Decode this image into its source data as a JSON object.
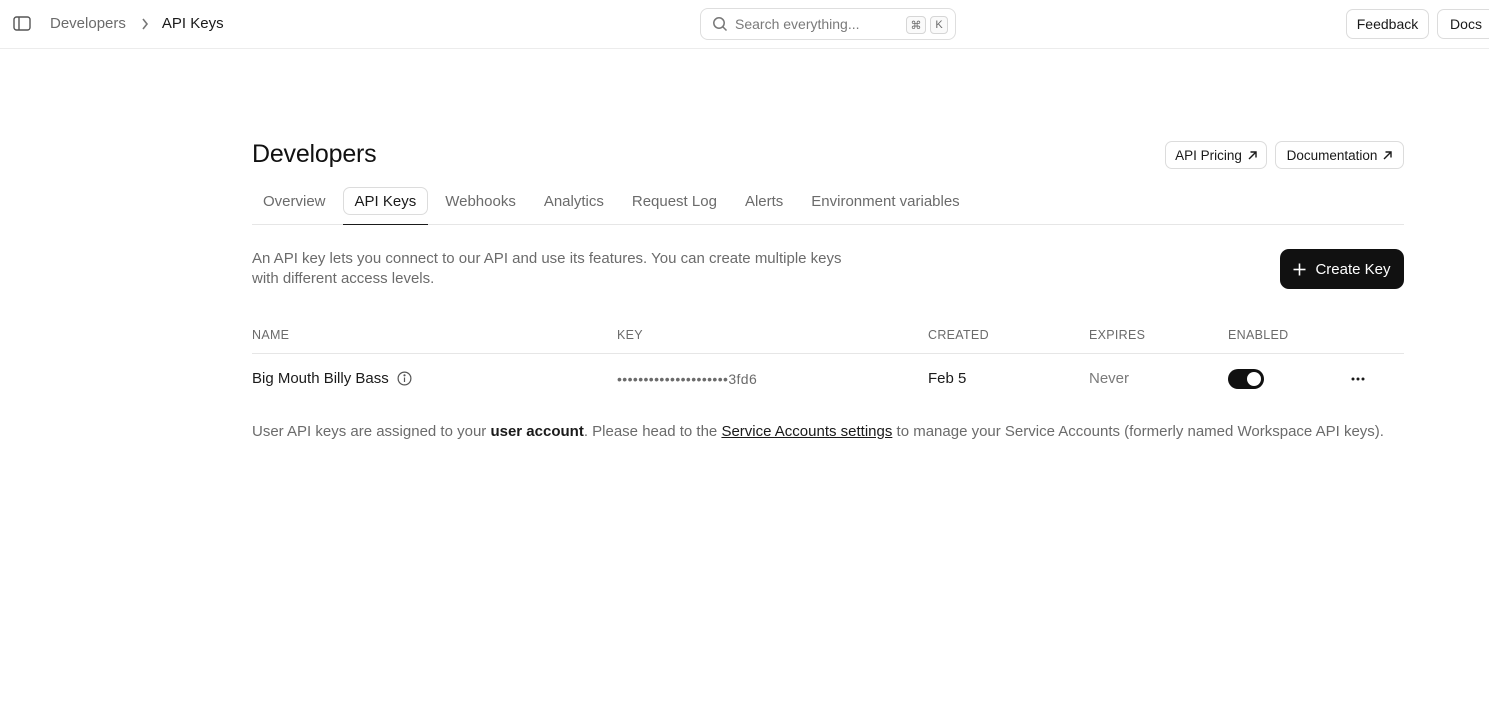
{
  "topbar": {
    "breadcrumb": {
      "parent": "Developers",
      "current": "API Keys"
    },
    "search": {
      "placeholder": "Search everything...",
      "shortcut_mod": "⌘",
      "shortcut_key": "K"
    },
    "feedback_label": "Feedback",
    "docs_label": "Docs"
  },
  "header": {
    "title": "Developers",
    "pricing_label": "API Pricing",
    "documentation_label": "Documentation"
  },
  "tabs": [
    {
      "label": "Overview",
      "active": false
    },
    {
      "label": "API Keys",
      "active": true
    },
    {
      "label": "Webhooks",
      "active": false
    },
    {
      "label": "Analytics",
      "active": false
    },
    {
      "label": "Request Log",
      "active": false
    },
    {
      "label": "Alerts",
      "active": false
    },
    {
      "label": "Environment variables",
      "active": false
    }
  ],
  "description": "An API key lets you connect to our API and use its features. You can create multiple keys with different access levels.",
  "create_label": "Create Key",
  "table": {
    "columns": {
      "name": "NAME",
      "key": "KEY",
      "created": "CREATED",
      "expires": "EXPIRES",
      "enabled": "ENABLED"
    },
    "rows": [
      {
        "name": "Big Mouth Billy Bass",
        "key": "•••••••••••••••••••••3fd6",
        "created": "Feb 5",
        "expires": "Never",
        "enabled": true
      }
    ]
  },
  "footnote": {
    "part1": "User API keys are assigned to your ",
    "bold": "user account",
    "part2": ". Please head to the ",
    "link": "Service Accounts settings",
    "part3": " to manage your Service Accounts (formerly named Workspace API keys)."
  },
  "colors": {
    "primary": "#111111",
    "muted_text": "#6b6b6b",
    "border": "#e6e6e6"
  }
}
